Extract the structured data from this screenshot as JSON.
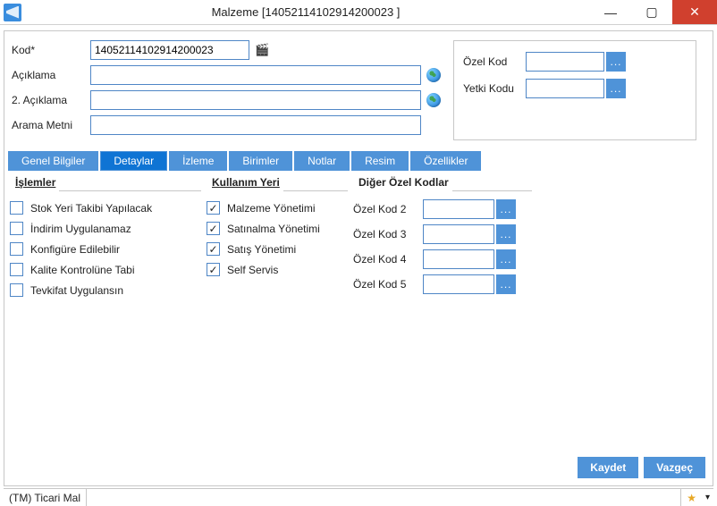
{
  "titlebar": {
    "title": "Malzeme [14052114102914200023 ]"
  },
  "header": {
    "labels": {
      "kod": "Kod*",
      "aciklama": "Açıklama",
      "aciklama2": "2. Açıklama",
      "arama": "Arama Metni"
    },
    "values": {
      "kod": "14052114102914200023",
      "aciklama": "",
      "aciklama2": "",
      "arama": ""
    },
    "side": {
      "ozel_kod": {
        "label": "Özel Kod",
        "value": ""
      },
      "yetki_kodu": {
        "label": "Yetki Kodu",
        "value": ""
      },
      "dots": "..."
    }
  },
  "tabs": [
    "Genel Bilgiler",
    "Detaylar",
    "İzleme",
    "Birimler",
    "Notlar",
    "Resim",
    "Özellikler"
  ],
  "active_tab": 1,
  "groups": {
    "islemler": {
      "title": "İşlemler",
      "items": [
        {
          "label": "Stok Yeri Takibi Yapılacak",
          "checked": false
        },
        {
          "label": "İndirim Uygulanamaz",
          "checked": false
        },
        {
          "label": "Konfigüre Edilebilir",
          "checked": false
        },
        {
          "label": "Kalite Kontrolüne Tabi",
          "checked": false
        },
        {
          "label": "Tevkifat Uygulansın",
          "checked": false
        }
      ]
    },
    "kullanim": {
      "title": "Kullanım Yeri",
      "items": [
        {
          "label": "Malzeme Yönetimi",
          "checked": true
        },
        {
          "label": "Satınalma Yönetimi",
          "checked": true
        },
        {
          "label": "Satış Yönetimi",
          "checked": true
        },
        {
          "label": "Self Servis",
          "checked": true
        }
      ]
    },
    "diger": {
      "title": "Diğer Özel Kodlar",
      "rows": [
        {
          "label": "Özel Kod 2",
          "value": ""
        },
        {
          "label": "Özel Kod 3",
          "value": ""
        },
        {
          "label": "Özel Kod 4",
          "value": ""
        },
        {
          "label": "Özel Kod 5",
          "value": ""
        }
      ],
      "dots": "..."
    }
  },
  "actions": {
    "save": "Kaydet",
    "cancel": "Vazgeç"
  },
  "status": {
    "text": "(TM) Ticari Mal",
    "star": "★",
    "drop": "▾"
  }
}
